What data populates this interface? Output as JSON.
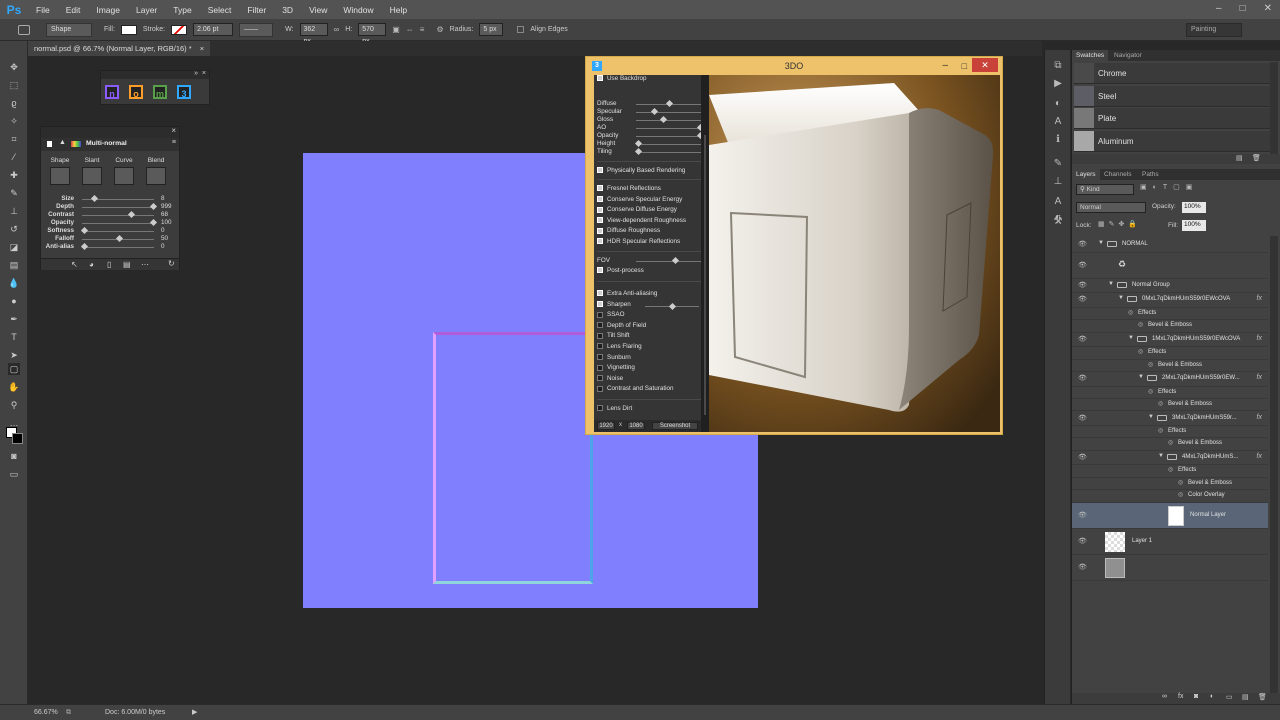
{
  "app": {
    "logo": "Ps",
    "menus": [
      "File",
      "Edit",
      "Image",
      "Layer",
      "Type",
      "Select",
      "Filter",
      "3D",
      "View",
      "Window",
      "Help"
    ],
    "workspace": "Painting"
  },
  "options": {
    "tool_mode": "Shape",
    "fill_label": "Fill:",
    "stroke_label": "Stroke:",
    "stroke_width": "2.06 pt",
    "w_label": "W:",
    "w_value": "362 px",
    "h_label": "H:",
    "h_value": "570 px",
    "radius_label": "Radius:",
    "radius_value": "5 px",
    "align_edges": "Align Edges"
  },
  "doc_tab": "normal.psd @ 66.7% (Normal Layer, RGB/16) *",
  "plugins": [
    {
      "glyph": "n",
      "color": "#8a5cff"
    },
    {
      "glyph": "o",
      "color": "#ff9d2b"
    },
    {
      "glyph": "m",
      "color": "#59a04a"
    },
    {
      "glyph": "3",
      "color": "#31a8ff"
    }
  ],
  "multinormal": {
    "title": "Multi-normal",
    "modes": [
      "Shape",
      "Slant",
      "Curve",
      "Blend"
    ],
    "params": [
      {
        "label": "Size",
        "value": "8",
        "level": 0.15
      },
      {
        "label": "Depth",
        "value": "999",
        "level": 1.0
      },
      {
        "label": "Contrast",
        "value": "68",
        "level": 0.68
      },
      {
        "label": "Opacity",
        "value": "100",
        "level": 1.0
      },
      {
        "label": "Softness",
        "value": "0",
        "level": 0.0
      },
      {
        "label": "Falloff",
        "value": "50",
        "level": 0.5
      },
      {
        "label": "Anti-alias",
        "value": "0",
        "level": 0.0
      }
    ]
  },
  "window3d": {
    "title": "3DO",
    "use_backdrop": "Use Backdrop",
    "sliders": [
      {
        "label": "Diffuse",
        "level": 0.5
      },
      {
        "label": "Specular",
        "level": 0.25
      },
      {
        "label": "Gloss",
        "level": 0.4
      },
      {
        "label": "AO",
        "level": 1.0
      },
      {
        "label": "Opacity",
        "level": 1.0
      },
      {
        "label": "Height",
        "level": 0.0
      },
      {
        "label": "Tiling",
        "level": 0.0
      }
    ],
    "pbr": "Physically Based Rendering",
    "checks1": [
      "Fresnel Reflections",
      "Conserve Specular Energy",
      "Conserve Diffuse Energy",
      "View-dependent Roughness",
      "Diffuse Roughness",
      "HDR Specular Reflections"
    ],
    "fov_label": "FOV",
    "fov_level": 0.6,
    "post_process": "Post-process",
    "post_checks": [
      {
        "label": "Extra Anti-aliasing",
        "on": true
      },
      {
        "label": "Sharpen",
        "on": true,
        "slider": 0.3
      },
      {
        "label": "SSAO",
        "on": false
      },
      {
        "label": "Depth of Field",
        "on": false
      },
      {
        "label": "Tilt Shift",
        "on": false
      },
      {
        "label": "Lens Flaring",
        "on": false
      },
      {
        "label": "Sunburn",
        "on": false
      },
      {
        "label": "Vignetting",
        "on": false
      },
      {
        "label": "Noise",
        "on": false
      },
      {
        "label": "Contrast and Saturation",
        "on": false
      }
    ],
    "lens_dirt": "Lens Dirt",
    "res_w": "1920",
    "res_x": "x",
    "res_h": "1080",
    "screenshot": "Screenshot"
  },
  "status": {
    "zoom": "66.67%",
    "doc": "Doc: 6.00M/0 bytes"
  },
  "swatches": {
    "tabs": [
      "Swatches",
      "Navigator"
    ],
    "items": [
      {
        "name": "Chrome",
        "color": "#4a4a4a"
      },
      {
        "name": "Steel",
        "color": "#5d5d65"
      },
      {
        "name": "Plate",
        "color": "#787878"
      },
      {
        "name": "Aluminum",
        "color": "#a8a8a8"
      }
    ]
  },
  "layers": {
    "tabs": [
      "Layers",
      "Channels",
      "Paths"
    ],
    "filter": "Kind",
    "blend": "Normal",
    "opacity_label": "Opacity:",
    "opacity": "100%",
    "lock_label": "Lock:",
    "fill_label": "Fill:",
    "fill": "100%",
    "rows": [
      {
        "name": "NORMAL",
        "indent": 0,
        "kind": "group",
        "eye": true
      },
      {
        "name": "",
        "indent": 1,
        "kind": "object",
        "eye": true
      },
      {
        "name": "Normal Group",
        "indent": 1,
        "kind": "group",
        "eye": true
      },
      {
        "name": "0MxL7qDkmHUmS59r0EWcOVA",
        "indent": 2,
        "kind": "group",
        "eye": true,
        "fx": true
      },
      {
        "name": "Effects",
        "indent": 3,
        "kind": "effects"
      },
      {
        "name": "Bevel & Emboss",
        "indent": 4,
        "kind": "effect"
      },
      {
        "name": "1MxL7qDkmHUmS59r0EWcOVA",
        "indent": 3,
        "kind": "group",
        "eye": true,
        "fx": true
      },
      {
        "name": "Effects",
        "indent": 4,
        "kind": "effects"
      },
      {
        "name": "Bevel & Emboss",
        "indent": 5,
        "kind": "effect"
      },
      {
        "name": "2MxL7qDkmHUmS59r0EW...",
        "indent": 4,
        "kind": "group",
        "eye": true,
        "fx": true
      },
      {
        "name": "Effects",
        "indent": 5,
        "kind": "effects"
      },
      {
        "name": "Bevel & Emboss",
        "indent": 6,
        "kind": "effect"
      },
      {
        "name": "3MxL7qDkmHUmS59r...",
        "indent": 5,
        "kind": "group",
        "eye": true,
        "fx": true
      },
      {
        "name": "Effects",
        "indent": 6,
        "kind": "effects"
      },
      {
        "name": "Bevel & Emboss",
        "indent": 7,
        "kind": "effect"
      },
      {
        "name": "4MxL7qDkmHUmS...",
        "indent": 6,
        "kind": "group",
        "eye": true,
        "fx": true
      },
      {
        "name": "Effects",
        "indent": 7,
        "kind": "effects"
      },
      {
        "name": "Bevel & Emboss",
        "indent": 8,
        "kind": "effect"
      },
      {
        "name": "Color Overlay",
        "indent": 8,
        "kind": "effect"
      },
      {
        "name": "Normal Layer",
        "indent": 8,
        "kind": "selected",
        "eye": true
      },
      {
        "name": "Layer 1",
        "indent": 0,
        "kind": "checker",
        "eye": true
      },
      {
        "name": "",
        "indent": 0,
        "kind": "gray",
        "eye": true
      }
    ]
  }
}
